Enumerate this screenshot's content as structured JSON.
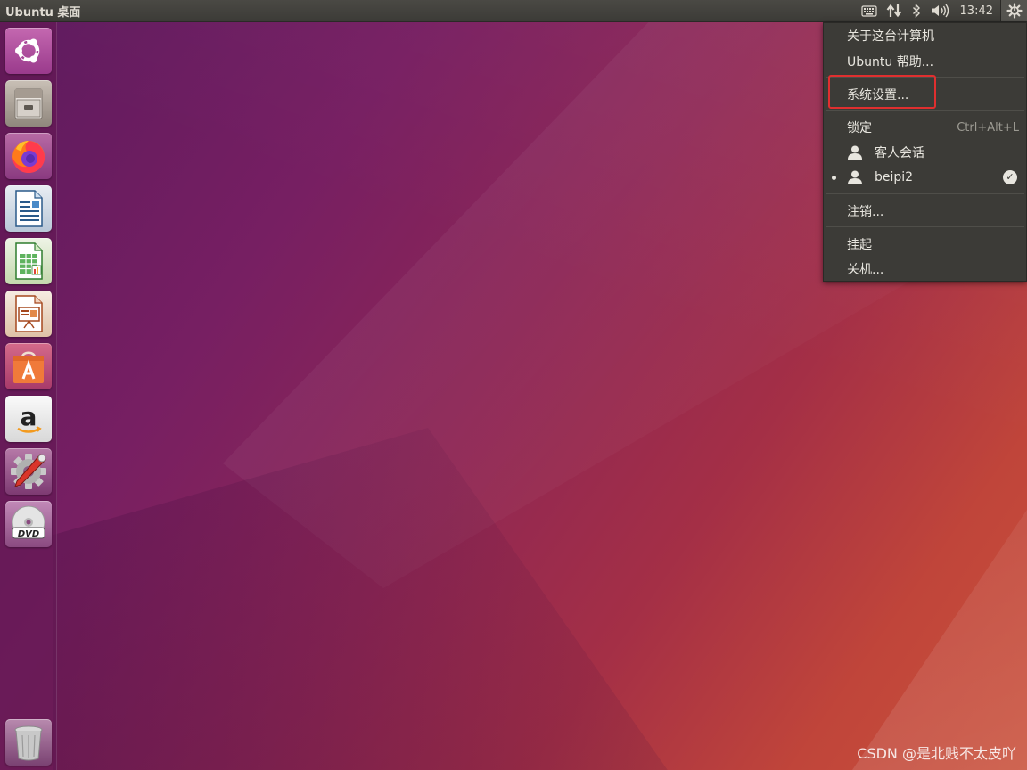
{
  "panel": {
    "title": "Ubuntu 桌面",
    "clock": "13:42",
    "indicators": [
      "keyboard-icon",
      "network-icon",
      "bluetooth-icon",
      "volume-icon",
      "session-gear-icon"
    ]
  },
  "launcher": {
    "items": [
      {
        "name": "ubuntu-dash",
        "icon": "ubuntu-logo-icon"
      },
      {
        "name": "files",
        "icon": "file-cabinet-icon"
      },
      {
        "name": "firefox",
        "icon": "firefox-icon"
      },
      {
        "name": "libreoffice-writer",
        "icon": "writer-document-icon"
      },
      {
        "name": "libreoffice-calc",
        "icon": "calc-spreadsheet-icon"
      },
      {
        "name": "libreoffice-impress",
        "icon": "impress-presentation-icon"
      },
      {
        "name": "ubuntu-software",
        "icon": "shopping-bag-icon"
      },
      {
        "name": "amazon",
        "icon": "amazon-icon"
      },
      {
        "name": "system-settings",
        "icon": "settings-wrench-icon"
      },
      {
        "name": "dvd",
        "icon": "dvd-icon"
      },
      {
        "name": "trash",
        "icon": "trash-icon"
      }
    ]
  },
  "menu": {
    "about": "关于这台计算机",
    "help": "Ubuntu 帮助...",
    "settings": "系统设置...",
    "lock": "锁定",
    "lock_shortcut": "Ctrl+Alt+L",
    "guest": "客人会话",
    "user": "beipi2",
    "logout": "注销...",
    "suspend": "挂起",
    "shutdown": "关机..."
  },
  "watermark": "CSDN @是北贱不太皮吖"
}
